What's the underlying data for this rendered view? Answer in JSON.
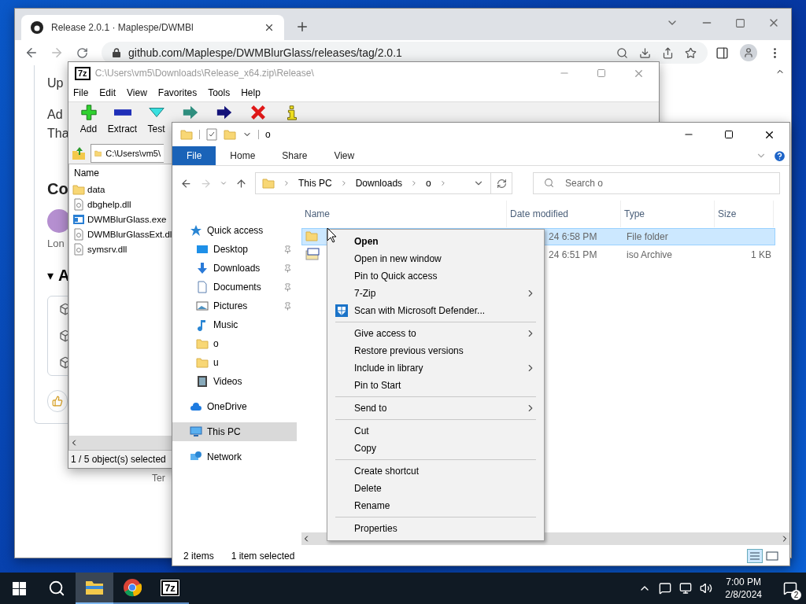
{
  "browser": {
    "tab_title": "Release 2.0.1 · Maplespe/DWMBl",
    "url": "github.com/Maplespe/DWMBlurGlass/releases/tag/2.0.1",
    "page": {
      "lines": [
        "Up",
        "Ad",
        "Tha"
      ],
      "heading": "Co",
      "author_note": "Lon",
      "section": "A",
      "section_toggle": "▾",
      "footer": "Ter"
    }
  },
  "archiver": {
    "logo": "7z",
    "title": "C:\\Users\\vm5\\Downloads\\Release_x64.zip\\Release\\",
    "menu": [
      "File",
      "Edit",
      "View",
      "Favorites",
      "Tools",
      "Help"
    ],
    "toolbar": [
      {
        "kind": "add",
        "label": "Add"
      },
      {
        "kind": "extract",
        "label": "Extract"
      },
      {
        "kind": "test",
        "label": "Test"
      },
      {
        "kind": "copy"
      },
      {
        "kind": "move"
      },
      {
        "kind": "delete"
      },
      {
        "kind": "info"
      }
    ],
    "path": "C:\\Users\\vm5\\",
    "column": "Name",
    "files": [
      {
        "kind": "folder",
        "name": "data"
      },
      {
        "kind": "dll",
        "name": "dbghelp.dll"
      },
      {
        "kind": "exe",
        "name": "DWMBlurGlass.exe"
      },
      {
        "kind": "dll",
        "name": "DWMBlurGlassExt.dl"
      },
      {
        "kind": "dll",
        "name": "symsrv.dll"
      }
    ],
    "status": "1 / 5 object(s) selected"
  },
  "explorer": {
    "title": "o",
    "ribbon_tabs": [
      {
        "label": "File",
        "selected": true
      },
      {
        "label": "Home",
        "selected": false
      },
      {
        "label": "Share",
        "selected": false
      },
      {
        "label": "View",
        "selected": false
      }
    ],
    "breadcrumb": [
      "This PC",
      "Downloads",
      "o"
    ],
    "search": {
      "placeholder": "Search o"
    },
    "nav": [
      {
        "label": "Quick access",
        "kind": "star",
        "selected": false,
        "children": [
          {
            "label": "Desktop",
            "kind": "desktop",
            "pinned": true,
            "selected": false
          },
          {
            "label": "Downloads",
            "kind": "download",
            "pinned": true,
            "selected": false
          },
          {
            "label": "Documents",
            "kind": "document",
            "pinned": true,
            "selected": false
          },
          {
            "label": "Pictures",
            "kind": "pictures",
            "pinned": true,
            "selected": false
          },
          {
            "label": "Music",
            "kind": "music",
            "pinned": false,
            "selected": false
          },
          {
            "label": "o",
            "kind": "folder",
            "pinned": false,
            "selected": false
          },
          {
            "label": "u",
            "kind": "folder",
            "pinned": false,
            "selected": false
          },
          {
            "label": "Videos",
            "kind": "videos",
            "pinned": false,
            "selected": false
          }
        ]
      },
      {
        "label": "OneDrive",
        "kind": "cloud",
        "selected": false
      },
      {
        "label": "This PC",
        "kind": "pc",
        "selected": true
      },
      {
        "label": "Network",
        "kind": "network",
        "selected": false
      }
    ],
    "columns": [
      "Name",
      "Date modified",
      "Type",
      "Size"
    ],
    "rows": [
      {
        "kind": "folder",
        "date": "24 6:58 PM",
        "type": "File folder",
        "selected": true
      },
      {
        "kind": "iso",
        "date": "24 6:51 PM",
        "type": "iso Archive",
        "size": "1 KB",
        "selected": false
      }
    ],
    "status": [
      "2 items",
      "1 item selected"
    ]
  },
  "context_menu": [
    [
      {
        "label": "Open",
        "kind": "plain",
        "bold": true,
        "submenu": false
      },
      {
        "label": "Open in new window",
        "kind": "plain",
        "bold": false,
        "submenu": false
      },
      {
        "label": "Pin to Quick access",
        "kind": "plain",
        "bold": false,
        "submenu": false
      },
      {
        "label": "7-Zip",
        "kind": "plain",
        "bold": false,
        "submenu": true
      },
      {
        "label": "Scan with Microsoft Defender...",
        "kind": "shield",
        "bold": false,
        "submenu": false
      }
    ],
    [
      {
        "label": "Give access to",
        "kind": "plain",
        "bold": false,
        "submenu": true
      },
      {
        "label": "Restore previous versions",
        "kind": "plain",
        "bold": false,
        "submenu": false
      },
      {
        "label": "Include in library",
        "kind": "plain",
        "bold": false,
        "submenu": true
      },
      {
        "label": "Pin to Start",
        "kind": "plain",
        "bold": false,
        "submenu": false
      }
    ],
    [
      {
        "label": "Send to",
        "kind": "plain",
        "bold": false,
        "submenu": true
      }
    ],
    [
      {
        "label": "Cut",
        "kind": "plain",
        "bold": false,
        "submenu": false
      },
      {
        "label": "Copy",
        "kind": "plain",
        "bold": false,
        "submenu": false
      }
    ],
    [
      {
        "label": "Create shortcut",
        "kind": "plain",
        "bold": false,
        "submenu": false
      },
      {
        "label": "Delete",
        "kind": "plain",
        "bold": false,
        "submenu": false
      },
      {
        "label": "Rename",
        "kind": "plain",
        "bold": false,
        "submenu": false
      }
    ],
    [
      {
        "label": "Properties",
        "kind": "plain",
        "bold": false,
        "submenu": false
      }
    ]
  ],
  "taskbar": {
    "apps": [
      {
        "kind": "explorer",
        "active": true
      },
      {
        "kind": "chrome",
        "active": false
      },
      {
        "kind": "sevenzip",
        "label": "7z",
        "active": false
      }
    ],
    "time": "7:00 PM",
    "date": "2/8/2024",
    "notifications": "2"
  }
}
